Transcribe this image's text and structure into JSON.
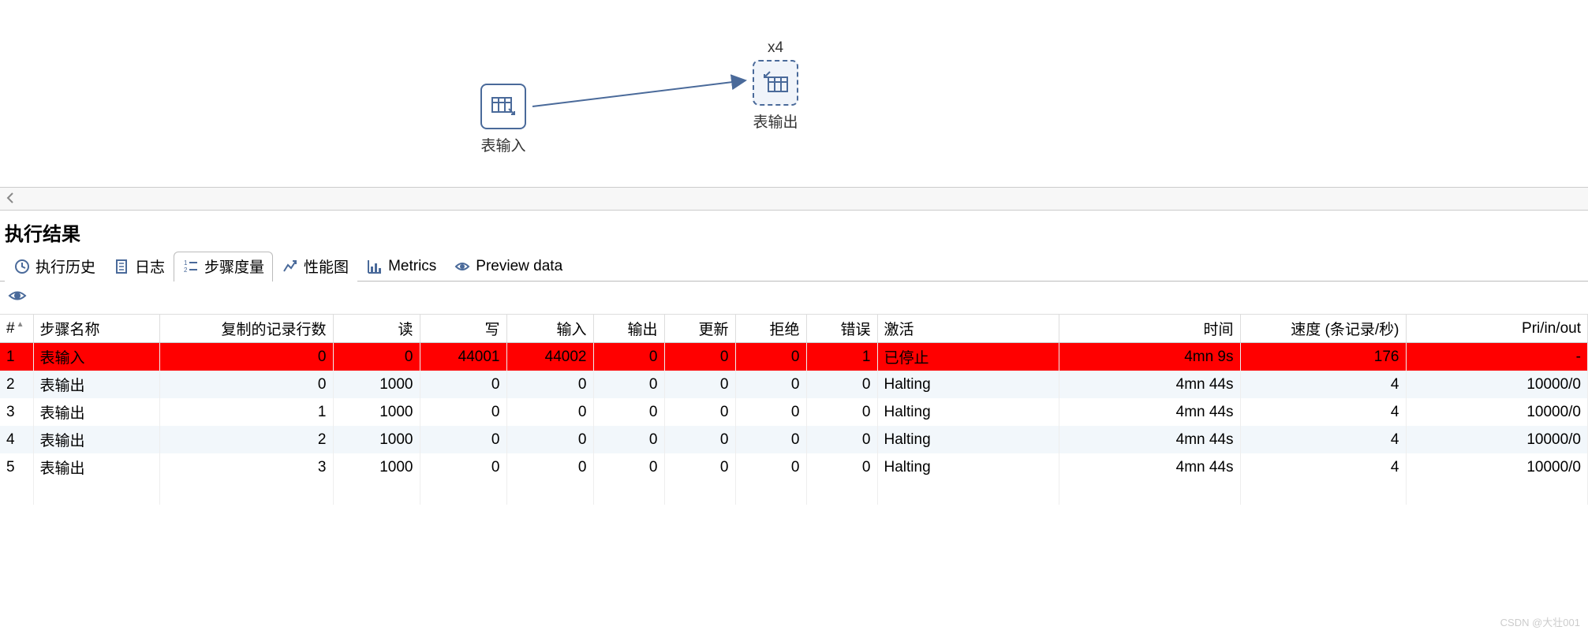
{
  "canvas": {
    "node_input": {
      "label": "表输入"
    },
    "node_output": {
      "label": "表输出",
      "multiplier": "x4"
    }
  },
  "results_title": "执行结果",
  "tabs": {
    "history": "执行历史",
    "log": "日志",
    "step_metrics": "步骤度量",
    "perf": "性能图",
    "metrics": "Metrics",
    "preview": "Preview data"
  },
  "table": {
    "headers": {
      "num": "#",
      "step_name": "步骤名称",
      "copied": "复制的记录行数",
      "read": "读",
      "write": "写",
      "input": "输入",
      "output": "输出",
      "update": "更新",
      "reject": "拒绝",
      "error": "错误",
      "active": "激活",
      "time": "时间",
      "speed": "速度 (条记录/秒)",
      "pri": "Pri/in/out"
    },
    "rows": [
      {
        "n": "1",
        "name": "表输入",
        "copied": "0",
        "read": "0",
        "write": "44001",
        "input": "44002",
        "output": "0",
        "update": "0",
        "reject": "0",
        "error": "1",
        "active": "已停止",
        "time": "4mn 9s",
        "speed": "176",
        "pri": "-",
        "is_error": true
      },
      {
        "n": "2",
        "name": "表输出",
        "copied": "0",
        "read": "1000",
        "write": "0",
        "input": "0",
        "output": "0",
        "update": "0",
        "reject": "0",
        "error": "0",
        "active": "Halting",
        "time": "4mn 44s",
        "speed": "4",
        "pri": "10000/0",
        "is_error": false
      },
      {
        "n": "3",
        "name": "表输出",
        "copied": "1",
        "read": "1000",
        "write": "0",
        "input": "0",
        "output": "0",
        "update": "0",
        "reject": "0",
        "error": "0",
        "active": "Halting",
        "time": "4mn 44s",
        "speed": "4",
        "pri": "10000/0",
        "is_error": false
      },
      {
        "n": "4",
        "name": "表输出",
        "copied": "2",
        "read": "1000",
        "write": "0",
        "input": "0",
        "output": "0",
        "update": "0",
        "reject": "0",
        "error": "0",
        "active": "Halting",
        "time": "4mn 44s",
        "speed": "4",
        "pri": "10000/0",
        "is_error": false
      },
      {
        "n": "5",
        "name": "表输出",
        "copied": "3",
        "read": "1000",
        "write": "0",
        "input": "0",
        "output": "0",
        "update": "0",
        "reject": "0",
        "error": "0",
        "active": "Halting",
        "time": "4mn 44s",
        "speed": "4",
        "pri": "10000/0",
        "is_error": false
      }
    ]
  },
  "watermark": "CSDN @大壮001"
}
